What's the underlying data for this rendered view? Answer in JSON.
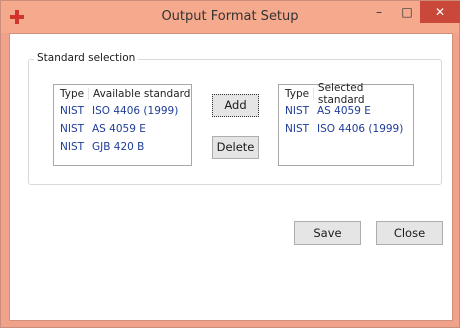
{
  "window": {
    "title": "Output Format Setup",
    "accent_color": "#f5a98d",
    "close_color": "#c9483a",
    "min_glyph": "–",
    "max_glyph": "□",
    "close_glyph": "✕"
  },
  "group": {
    "legend": "Standard selection"
  },
  "available": {
    "header_type": "Type",
    "header_name": "Available standard",
    "rows": [
      {
        "type": "NIST",
        "name": "ISO 4406 (1999)"
      },
      {
        "type": "NIST",
        "name": "AS 4059 E"
      },
      {
        "type": "NIST",
        "name": "GJB 420 B"
      }
    ]
  },
  "selected": {
    "header_type": "Type",
    "header_name": "Selected standard",
    "rows": [
      {
        "type": "NIST",
        "name": "AS 4059 E"
      },
      {
        "type": "NIST",
        "name": "ISO 4406 (1999)"
      }
    ]
  },
  "buttons": {
    "add": "Add",
    "delete": "Delete",
    "save": "Save",
    "close": "Close"
  }
}
